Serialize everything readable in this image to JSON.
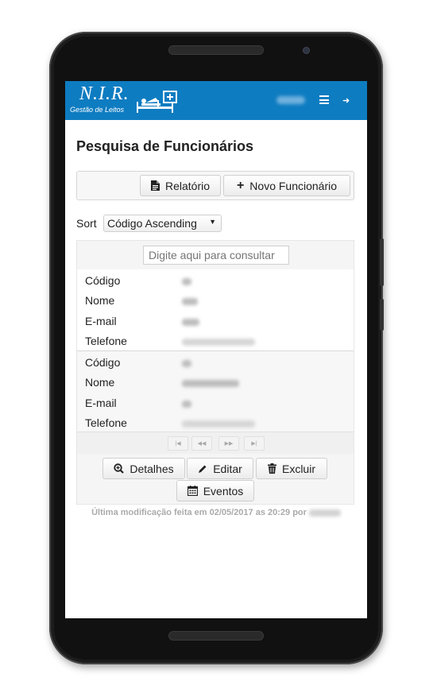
{
  "app": {
    "logo_title": "N.I.R.",
    "logo_subtitle": "Gestão de Leitos",
    "brand_color": "#0e7cc1"
  },
  "page": {
    "title": "Pesquisa de Funcionários"
  },
  "toolbar": {
    "report_label": "Relatório",
    "new_label": "Novo Funcionário"
  },
  "sort": {
    "label": "Sort",
    "selected": "Código Ascending"
  },
  "search": {
    "placeholder": "Digite aqui para consultar"
  },
  "records": [
    {
      "labels": {
        "code": "Código",
        "name": "Nome",
        "email": "E-mail",
        "phone": "Telefone"
      }
    },
    {
      "labels": {
        "code": "Código",
        "name": "Nome",
        "email": "E-mail",
        "phone": "Telefone"
      }
    }
  ],
  "actions": {
    "details_label": "Detalhes",
    "edit_label": "Editar",
    "delete_label": "Excluir",
    "events_label": "Eventos"
  },
  "footer": {
    "last_modified": "Última modificação feita em 02/05/2017 as 20:29 por"
  }
}
